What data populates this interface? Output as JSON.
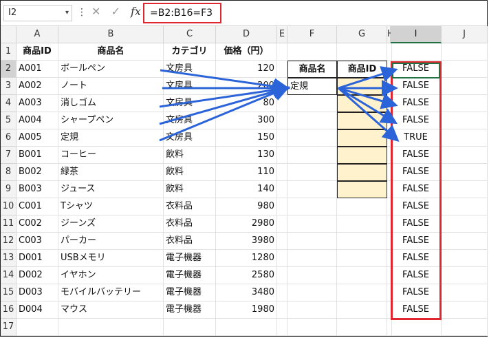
{
  "name_box": "I2",
  "formula": "=B2:B16=F3",
  "columns": [
    "A",
    "B",
    "C",
    "D",
    "E",
    "F",
    "G",
    "H",
    "I",
    "J"
  ],
  "rows": [
    "1",
    "2",
    "3",
    "4",
    "5",
    "6",
    "7",
    "8",
    "9",
    "10",
    "11",
    "12",
    "13",
    "14",
    "15",
    "16",
    "17"
  ],
  "headers": {
    "id": "商品ID",
    "name": "商品名",
    "cat": "カテゴリ",
    "price": "価格（円）"
  },
  "data": [
    {
      "id": "A001",
      "name": "ボールペン",
      "cat": "文房具",
      "price": "120"
    },
    {
      "id": "A002",
      "name": "ノート",
      "cat": "文房具",
      "price": "200"
    },
    {
      "id": "A003",
      "name": "消しゴム",
      "cat": "文房具",
      "price": "80"
    },
    {
      "id": "A004",
      "name": "シャープペン",
      "cat": "文房具",
      "price": "300"
    },
    {
      "id": "A005",
      "name": "定規",
      "cat": "文房具",
      "price": "150"
    },
    {
      "id": "B001",
      "name": "コーヒー",
      "cat": "飲料",
      "price": "130"
    },
    {
      "id": "B002",
      "name": "緑茶",
      "cat": "飲料",
      "price": "110"
    },
    {
      "id": "B003",
      "name": "ジュース",
      "cat": "飲料",
      "price": "140"
    },
    {
      "id": "C001",
      "name": "Tシャツ",
      "cat": "衣料品",
      "price": "980"
    },
    {
      "id": "C002",
      "name": "ジーンズ",
      "cat": "衣料品",
      "price": "2980"
    },
    {
      "id": "C003",
      "name": "パーカー",
      "cat": "衣料品",
      "price": "3980"
    },
    {
      "id": "D001",
      "name": "USBメモリ",
      "cat": "電子機器",
      "price": "1280"
    },
    {
      "id": "D002",
      "name": "イヤホン",
      "cat": "電子機器",
      "price": "2580"
    },
    {
      "id": "D003",
      "name": "モバイルバッテリー",
      "cat": "電子機器",
      "price": "3480"
    },
    {
      "id": "D004",
      "name": "マウス",
      "cat": "電子機器",
      "price": "1980"
    }
  ],
  "lookup": {
    "name_header": "商品名",
    "id_header": "商品ID",
    "name_value": "定規"
  },
  "results": [
    "FALSE",
    "FALSE",
    "FALSE",
    "FALSE",
    "TRUE",
    "FALSE",
    "FALSE",
    "FALSE",
    "FALSE",
    "FALSE",
    "FALSE",
    "FALSE",
    "FALSE",
    "FALSE",
    "FALSE"
  ],
  "colors": {
    "highlight_red": "#e0262f",
    "arrow_blue": "#2b63d9",
    "yellow_fill": "#fff2cc",
    "select_green": "#217346"
  }
}
